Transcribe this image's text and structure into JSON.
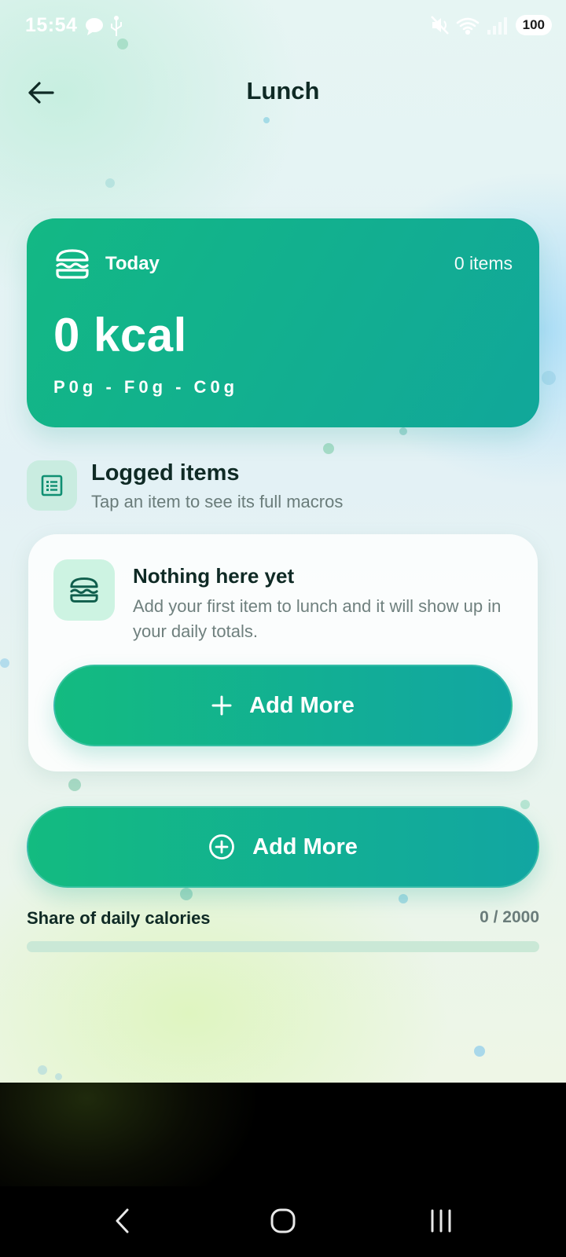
{
  "status_bar": {
    "time": "15:54",
    "battery": "100",
    "left_icons": [
      "chat-bubble-icon",
      "usb-icon"
    ],
    "right_icons": [
      "mute-icon",
      "wifi-icon",
      "signal-icon"
    ]
  },
  "header": {
    "title": "Lunch",
    "back_icon": "arrow-left-icon"
  },
  "summary": {
    "icon": "burger-icon",
    "day_label": "Today",
    "item_count": "0 items",
    "kcal": "0 kcal",
    "macros": "P0g - F0g - C0g"
  },
  "logged": {
    "icon": "list-icon",
    "title": "Logged items",
    "subtitle": "Tap an item to see its full macros"
  },
  "empty_state": {
    "icon": "burger-icon",
    "title": "Nothing here yet",
    "body": "Add your first item to lunch and it will show up in your daily totals.",
    "button_label": "Add More",
    "button_icon": "plus-icon"
  },
  "add_more": {
    "label": "Add More",
    "icon": "plus-circle-icon"
  },
  "share": {
    "label": "Share of daily calories",
    "value": "0 / 2000",
    "progress_fraction": 0
  },
  "nav_bar": [
    "back-nav-icon",
    "home-nav-icon",
    "recents-nav-icon"
  ],
  "colors": {
    "accent_start": "#13b884",
    "accent_end": "#11a79a",
    "text_dark": "#0f2a25",
    "text_muted": "#6a7c7a"
  }
}
